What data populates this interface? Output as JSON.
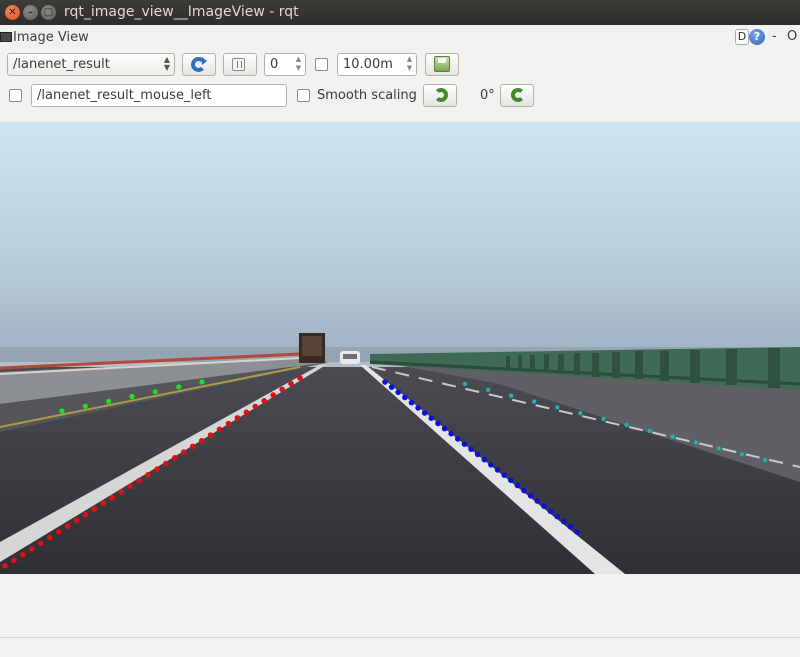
{
  "window": {
    "title": "rqt_image_view__ImageView - rqt",
    "close_glyph": "✕",
    "min_glyph": "–",
    "max_glyph": "□"
  },
  "dock": {
    "title": "Image View",
    "d_label": "D",
    "help_label": "?",
    "minimize_label": "-",
    "close_label": "O"
  },
  "toolbar": {
    "topic_value": "/lanenet_result",
    "frame_value": "0",
    "duration_value": "10.00m",
    "mouse_topic_value": "/lanenet_result_mouse_left",
    "smooth_scaling_label": "Smooth scaling",
    "rotation_label": "0°"
  },
  "colors": {
    "left_lane_points": "#e01010",
    "outer_left_points": "#22dd22",
    "right_lane_points": "#1010dd",
    "outer_right_points": "#20b0b0"
  }
}
